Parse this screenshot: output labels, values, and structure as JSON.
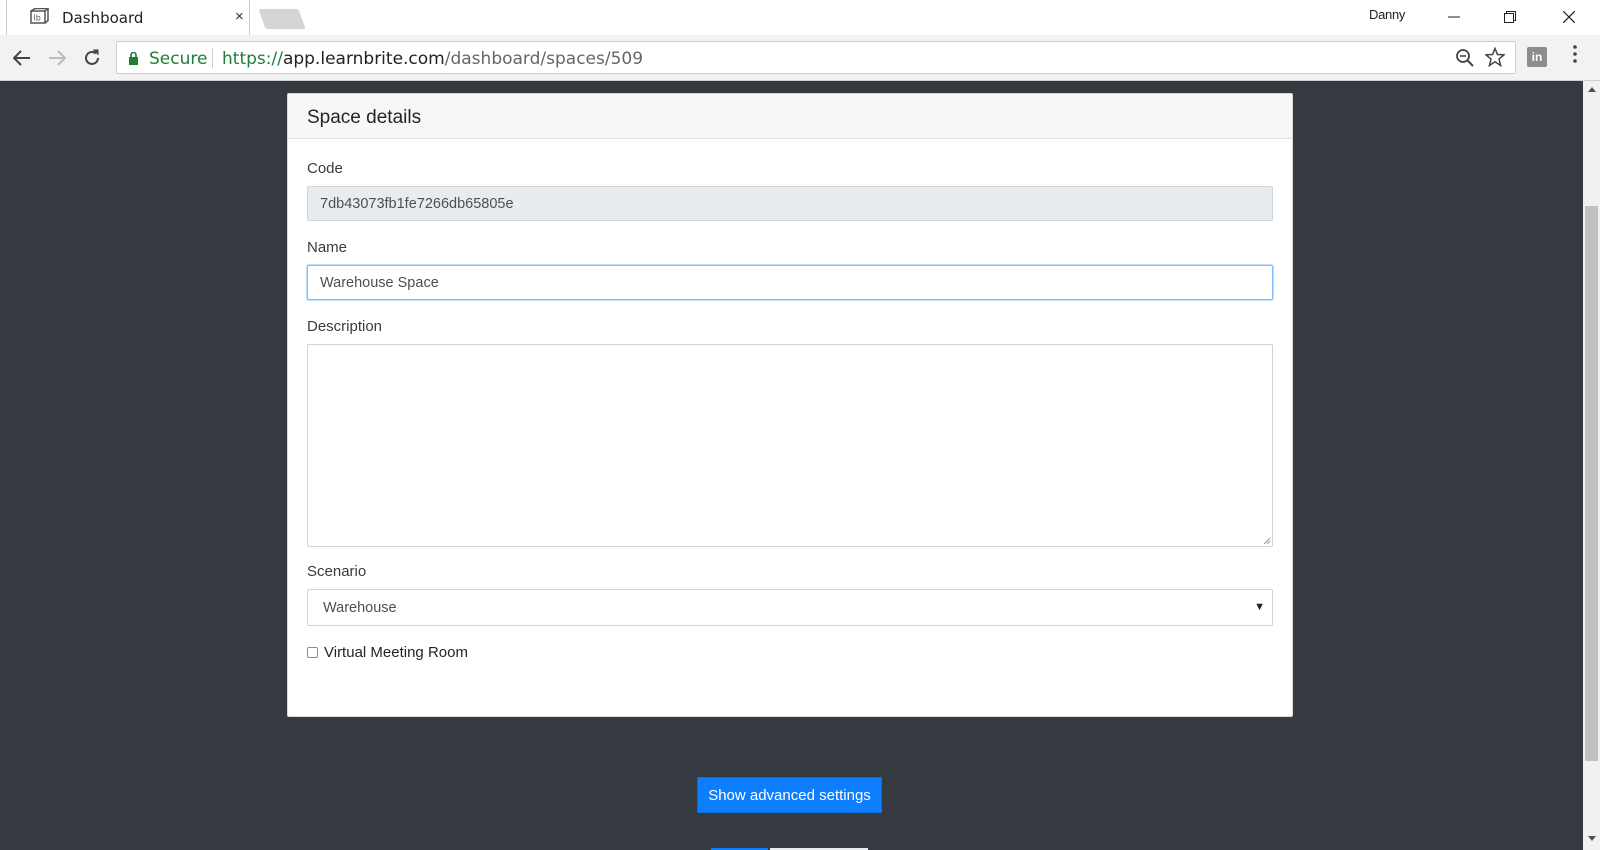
{
  "browser": {
    "tab": {
      "title": "Dashboard",
      "close_glyph": "×",
      "favicon": "learnbrite-favicon"
    },
    "profile_name": "Danny",
    "window_controls": [
      "minimize-icon",
      "restore-icon",
      "close-icon"
    ],
    "security_label": "Secure",
    "url": {
      "scheme": "https://",
      "host": "app.learnbrite.com",
      "path": "/dashboard/spaces/509"
    },
    "extension_label": "in"
  },
  "card": {
    "title": "Space details",
    "code": {
      "label": "Code",
      "value": "7db43073fb1fe7266db65805e"
    },
    "name": {
      "label": "Name",
      "value": "Warehouse Space"
    },
    "description": {
      "label": "Description",
      "value": ""
    },
    "scenario": {
      "label": "Scenario",
      "value": "Warehouse",
      "caret": "▼"
    },
    "virtual_meeting": {
      "label": "Virtual Meeting Room",
      "checked": false
    }
  },
  "actions": {
    "advanced_settings_label": "Show advanced settings"
  },
  "colors": {
    "page_bg": "#343a40",
    "primary": "#0d7efd",
    "secure_green": "#1e7e34"
  }
}
